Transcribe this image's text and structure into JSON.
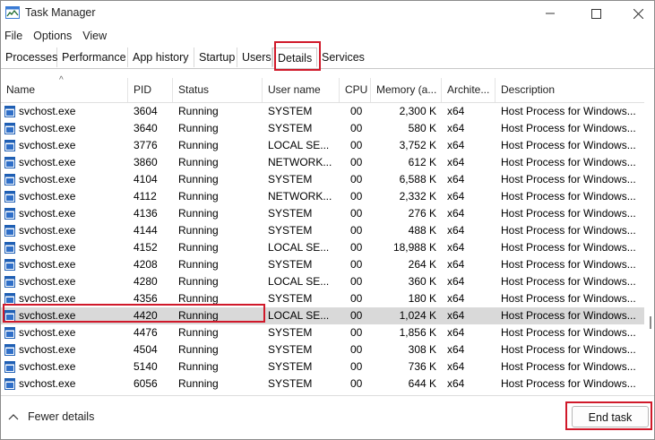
{
  "window": {
    "title": "Task Manager"
  },
  "menu": [
    "File",
    "Options",
    "View"
  ],
  "tabs": [
    "Processes",
    "Performance",
    "App history",
    "Startup",
    "Users",
    "Details",
    "Services"
  ],
  "active_tab": "Details",
  "columns": [
    "Name",
    "PID",
    "Status",
    "User name",
    "CPU",
    "Memory (a...",
    "Archite...",
    "Description"
  ],
  "rows": [
    [
      "svchost.exe",
      "3604",
      "Running",
      "SYSTEM",
      "00",
      "2,300 K",
      "x64",
      "Host Process for Windows..."
    ],
    [
      "svchost.exe",
      "3640",
      "Running",
      "SYSTEM",
      "00",
      "580 K",
      "x64",
      "Host Process for Windows..."
    ],
    [
      "svchost.exe",
      "3776",
      "Running",
      "LOCAL SE...",
      "00",
      "3,752 K",
      "x64",
      "Host Process for Windows..."
    ],
    [
      "svchost.exe",
      "3860",
      "Running",
      "NETWORK...",
      "00",
      "612 K",
      "x64",
      "Host Process for Windows..."
    ],
    [
      "svchost.exe",
      "4104",
      "Running",
      "SYSTEM",
      "00",
      "6,588 K",
      "x64",
      "Host Process for Windows..."
    ],
    [
      "svchost.exe",
      "4112",
      "Running",
      "NETWORK...",
      "00",
      "2,332 K",
      "x64",
      "Host Process for Windows..."
    ],
    [
      "svchost.exe",
      "4136",
      "Running",
      "SYSTEM",
      "00",
      "276 K",
      "x64",
      "Host Process for Windows..."
    ],
    [
      "svchost.exe",
      "4144",
      "Running",
      "SYSTEM",
      "00",
      "488 K",
      "x64",
      "Host Process for Windows..."
    ],
    [
      "svchost.exe",
      "4152",
      "Running",
      "LOCAL SE...",
      "00",
      "18,988 K",
      "x64",
      "Host Process for Windows..."
    ],
    [
      "svchost.exe",
      "4208",
      "Running",
      "SYSTEM",
      "00",
      "264 K",
      "x64",
      "Host Process for Windows..."
    ],
    [
      "svchost.exe",
      "4280",
      "Running",
      "LOCAL SE...",
      "00",
      "360 K",
      "x64",
      "Host Process for Windows..."
    ],
    [
      "svchost.exe",
      "4356",
      "Running",
      "SYSTEM",
      "00",
      "180 K",
      "x64",
      "Host Process for Windows..."
    ],
    [
      "svchost.exe",
      "4420",
      "Running",
      "LOCAL SE...",
      "00",
      "1,024 K",
      "x64",
      "Host Process for Windows..."
    ],
    [
      "svchost.exe",
      "4476",
      "Running",
      "SYSTEM",
      "00",
      "1,856 K",
      "x64",
      "Host Process for Windows..."
    ],
    [
      "svchost.exe",
      "4504",
      "Running",
      "SYSTEM",
      "00",
      "308 K",
      "x64",
      "Host Process for Windows..."
    ],
    [
      "svchost.exe",
      "5140",
      "Running",
      "SYSTEM",
      "00",
      "736 K",
      "x64",
      "Host Process for Windows..."
    ],
    [
      "svchost.exe",
      "6056",
      "Running",
      "SYSTEM",
      "00",
      "644 K",
      "x64",
      "Host Process for Windows..."
    ]
  ],
  "selected_row": 12,
  "footer": {
    "fewer_details": "Fewer details",
    "end_task": "End task"
  },
  "colors": {
    "highlight": "#d0192a",
    "selected_row": "#d9d9d9"
  },
  "icons": {
    "app": "task-manager-icon",
    "process": "process-window-icon",
    "sort": "sort-ascending-icon",
    "collapse": "chevron-up-icon"
  }
}
